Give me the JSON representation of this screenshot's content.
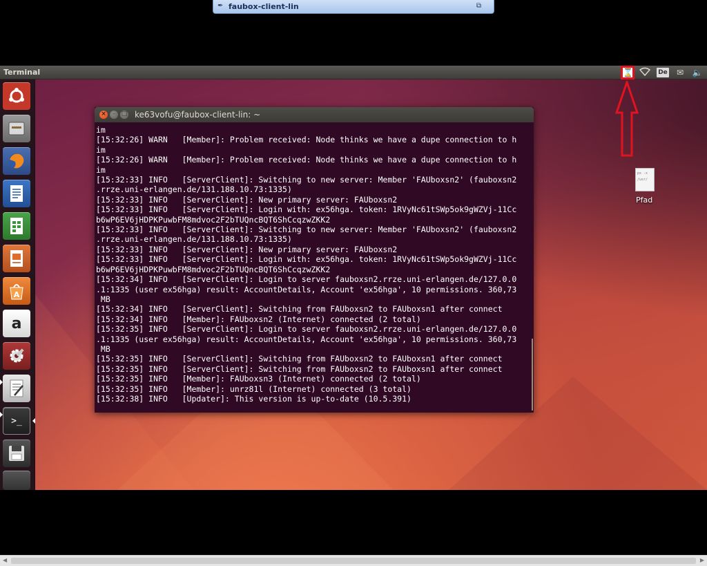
{
  "viewer": {
    "tab_title": "faubox-client-lin",
    "pin_icon": "pin-icon",
    "restore_icon": "restore-icon"
  },
  "top_panel": {
    "app_title": "Terminal",
    "keyboard_layout": "De",
    "indicators": [
      "hourglass-icon",
      "wifi-icon",
      "keyboard-layout-indicator",
      "mail-icon",
      "sound-icon"
    ]
  },
  "launcher": {
    "items": [
      {
        "name": "ubuntu-dash-icon"
      },
      {
        "name": "files-icon"
      },
      {
        "name": "firefox-icon"
      },
      {
        "name": "writer-icon"
      },
      {
        "name": "calc-icon"
      },
      {
        "name": "impress-icon"
      },
      {
        "name": "software-center-icon"
      },
      {
        "name": "amazon-icon",
        "glyph": "a"
      },
      {
        "name": "system-settings-icon"
      },
      {
        "name": "text-editor-icon"
      },
      {
        "name": "terminal-icon",
        "glyph": ">_"
      },
      {
        "name": "floppy-disk-icon"
      },
      {
        "name": "trash-icon"
      }
    ]
  },
  "desktop": {
    "file_label": "Pfad",
    "file_preview": [
      "ps -x",
      "/usr/"
    ]
  },
  "terminal": {
    "title": "ke63vofu@faubox-client-lin: ~",
    "lines": [
      "im",
      "[15:32:26] WARN   [Member]: Problem received: Node thinks we have a dupe connection to h",
      "im",
      "[15:32:26] WARN   [Member]: Problem received: Node thinks we have a dupe connection to h",
      "im",
      "[15:32:33] INFO   [ServerClient]: Switching to new server: Member 'FAUboxsn2' (fauboxsn2",
      ".rrze.uni-erlangen.de/131.188.10.73:1335)",
      "[15:32:33] INFO   [ServerClient]: New primary server: FAUboxsn2",
      "[15:32:33] INFO   [ServerClient]: Login with: ex56hga. token: 1RVyNc61tSWp5ok9gWZVj-11Cc",
      "b6wP6EV6jHDPKPuwbFM8mdvoc2F2bTUQncBQT6ShCcqzwZKK2",
      "[15:32:33] INFO   [ServerClient]: Switching to new server: Member 'FAUboxsn2' (fauboxsn2",
      ".rrze.uni-erlangen.de/131.188.10.73:1335)",
      "[15:32:33] INFO   [ServerClient]: New primary server: FAUboxsn2",
      "[15:32:33] INFO   [ServerClient]: Login with: ex56hga. token: 1RVyNc61tSWp5ok9gWZVj-11Cc",
      "b6wP6EV6jHDPKPuwbFM8mdvoc2F2bTUQncBQT6ShCcqzwZKK2",
      "[15:32:34] INFO   [ServerClient]: Login to server fauboxsn2.rrze.uni-erlangen.de/127.0.0",
      ".1:1335 (user ex56hga) result: AccountDetails, Account 'ex56hga', 10 permissions. 360,73",
      " MB",
      "[15:32:34] INFO   [ServerClient]: Switching from FAUboxsn2 to FAUboxsn1 after connect",
      "[15:32:34] INFO   [Member]: FAUboxsn2 (Internet) connected (2 total)",
      "[15:32:35] INFO   [ServerClient]: Login to server fauboxsn2.rrze.uni-erlangen.de/127.0.0",
      ".1:1335 (user ex56hga) result: AccountDetails, Account 'ex56hga', 10 permissions. 360,73",
      " MB",
      "[15:32:35] INFO   [ServerClient]: Switching from FAUboxsn2 to FAUboxsn1 after connect",
      "[15:32:35] INFO   [ServerClient]: Switching from FAUboxsn2 to FAUboxsn1 after connect",
      "[15:32:35] INFO   [Member]: FAUboxsn3 (Internet) connected (2 total)",
      "[15:32:35] INFO   [Member]: unrz81l (Internet) connected (3 total)",
      "[15:32:38] INFO   [Updater]: This version is up-to-date (10.5.391)"
    ]
  },
  "colors": {
    "annotation_red": "#e0141f",
    "terminal_bg": "#300a24",
    "close_button": "#dd4814"
  }
}
